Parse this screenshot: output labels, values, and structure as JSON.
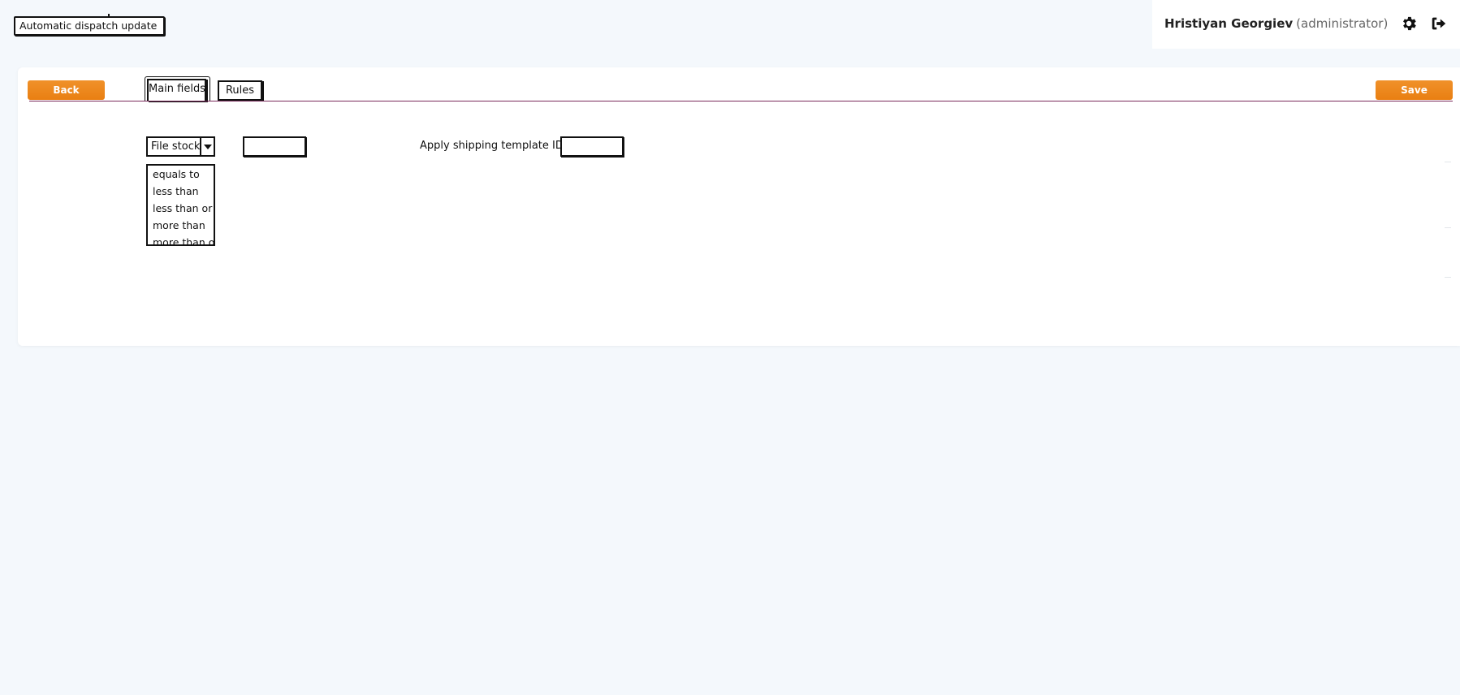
{
  "page": {
    "title": "Automatic dispatch update"
  },
  "user": {
    "name": "Hristiyan Georgiev",
    "role": "(administrator)"
  },
  "icons": {
    "settings": "gear-icon",
    "logout": "logout-icon",
    "dropdown": "chevron-down-icon"
  },
  "toolbar": {
    "back_label": "Back",
    "save_label": "Save"
  },
  "tabs": [
    {
      "label": "Main fields",
      "active": true
    },
    {
      "label": "Rules",
      "active": false
    }
  ],
  "filter": {
    "field_selected": "File stock",
    "operator_options": [
      "equals to",
      "less than",
      "less than or",
      "more than",
      "more than or"
    ],
    "value": ""
  },
  "template": {
    "label": "Apply shipping template ID",
    "value": ""
  },
  "colors": {
    "accent": "#e97f12",
    "tab_divider": "#7a2a5a",
    "background": "#f4f8fc"
  }
}
